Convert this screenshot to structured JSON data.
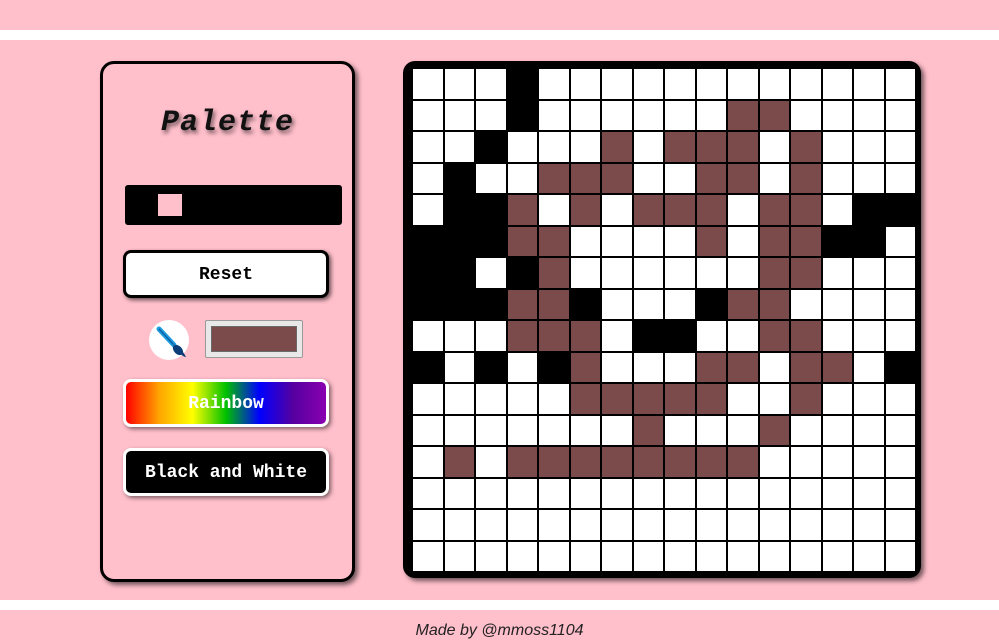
{
  "palette": {
    "title": "Palette",
    "current_swatch_color": "#ffbfcb",
    "reset_label": "Reset",
    "brush_icon": "paintbrush-icon",
    "picker_value": "#7b4a4a",
    "rainbow_label": "Rainbow",
    "bw_label": "Black and White"
  },
  "grid": {
    "size": 16,
    "colors": {
      "W": "#ffffff",
      "K": "#000000",
      "B": "#7b4a4a"
    },
    "rows": [
      "WWWKWWWWWWWWWWWW",
      "WWWKWWWWWWBBWWWW",
      "WWKWWWBWBBBWBWWW",
      "WKWWBBBWWBBWBWWW",
      "WKKBWBWBBBWBBWKK",
      "KKKBBWWWWBWBBKKW",
      "KKWKBWWWWWWBBWWW",
      "KKKBBKWWWKBBWWWW",
      "WWWBBBWKKWWBBWWW",
      "KWKWKBWWWBBWBBWK",
      "WWWWWBBBBBWWBWWW",
      "WWWWWWWBWWWBWWWW",
      "WBWBBBBBBBBWWWWW",
      "WWWWWWWWWWWWWWWW",
      "WWWWWWWWWWWWWWWW",
      "WWWWWWWWWWWWWWWW"
    ]
  },
  "footer": {
    "text": "Made by @mmoss1104"
  }
}
